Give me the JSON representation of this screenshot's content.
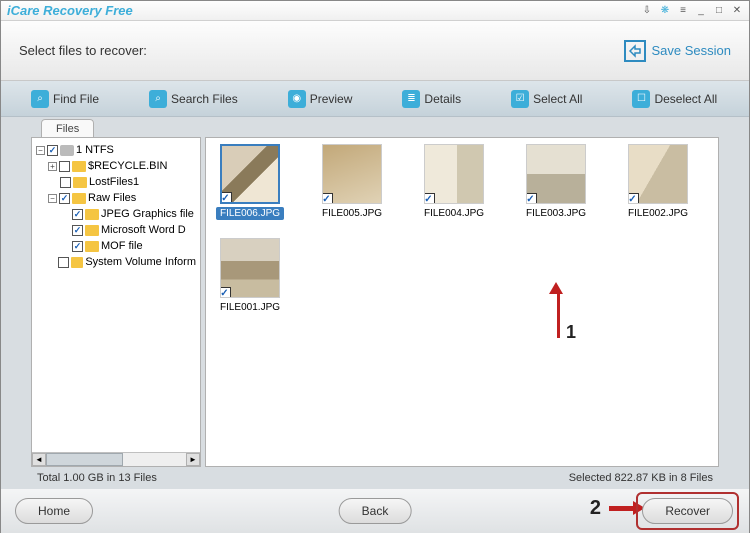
{
  "app": {
    "title": "iCare Recovery Free"
  },
  "header": {
    "prompt": "Select files to recover:",
    "save_session": "Save Session"
  },
  "toolbar": {
    "find_file": "Find File",
    "search_files": "Search Files",
    "preview": "Preview",
    "details": "Details",
    "select_all": "Select All",
    "deselect_all": "Deselect All"
  },
  "tabs": {
    "files": "Files"
  },
  "tree": {
    "root": "1 NTFS",
    "recycle": "$RECYCLE.BIN",
    "lost": "LostFiles1",
    "raw": "Raw Files",
    "jpeg": "JPEG Graphics file",
    "word": "Microsoft Word D",
    "mof": "MOF file",
    "svi": "System Volume Inform"
  },
  "files": [
    {
      "name": "FILE006.JPG",
      "checked": true,
      "selected": true,
      "thumb": "room1"
    },
    {
      "name": "FILE005.JPG",
      "checked": true,
      "selected": false,
      "thumb": "room2"
    },
    {
      "name": "FILE004.JPG",
      "checked": true,
      "selected": false,
      "thumb": "room3"
    },
    {
      "name": "FILE003.JPG",
      "checked": true,
      "selected": false,
      "thumb": "room4"
    },
    {
      "name": "FILE002.JPG",
      "checked": true,
      "selected": false,
      "thumb": "room5"
    },
    {
      "name": "FILE001.JPG",
      "checked": true,
      "selected": false,
      "thumb": "room6"
    }
  ],
  "status": {
    "total": "Total 1.00 GB in 13 Files",
    "selected": "Selected 822.87 KB in 8 Files"
  },
  "footer": {
    "home": "Home",
    "back": "Back",
    "recover": "Recover"
  },
  "annotations": {
    "one": "1",
    "two": "2"
  }
}
